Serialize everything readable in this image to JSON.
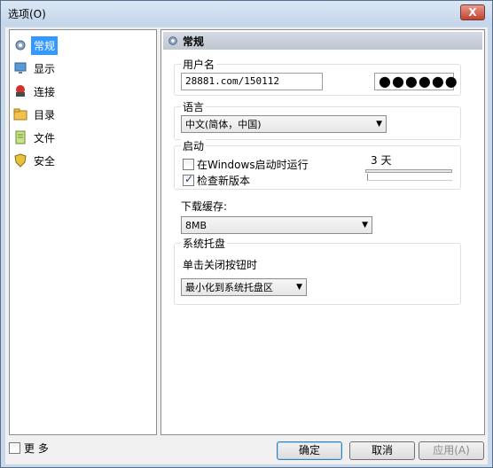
{
  "window": {
    "title": "选项(O)",
    "close_label": "X"
  },
  "sidebar": {
    "items": [
      {
        "label": "常规",
        "icon": "gear-icon",
        "active": true
      },
      {
        "label": "显示",
        "icon": "monitor-icon",
        "active": false
      },
      {
        "label": "连接",
        "icon": "network-icon",
        "active": false
      },
      {
        "label": "目录",
        "icon": "folder-icon",
        "active": false
      },
      {
        "label": "文件",
        "icon": "file-icon",
        "active": false
      },
      {
        "label": "安全",
        "icon": "shield-icon",
        "active": false
      }
    ],
    "more_label": "更 多"
  },
  "panel": {
    "title": "常规",
    "username": {
      "label": "用户名",
      "value": "28881.com/150112",
      "password": "●●●●●●"
    },
    "language": {
      "label": "语言",
      "selected": "中文(简体，中国)"
    },
    "startup": {
      "label": "启动",
      "run_on_startup": {
        "label": "在Windows启动时运行",
        "checked": false
      },
      "check_updates": {
        "label": "检查新版本",
        "checked": true
      },
      "days_value": "3 天"
    },
    "cache": {
      "label": "下载缓存:",
      "selected": "8MB"
    },
    "tray": {
      "label": "系统托盘",
      "close_action_label": "单击关闭按钮时",
      "close_action_selected": "最小化到系统托盘区"
    }
  },
  "buttons": {
    "ok": "确定",
    "cancel": "取消",
    "apply": "应用(A)"
  },
  "colors": {
    "accent": "#3399ff",
    "title_bar": "#c9d9ec"
  }
}
